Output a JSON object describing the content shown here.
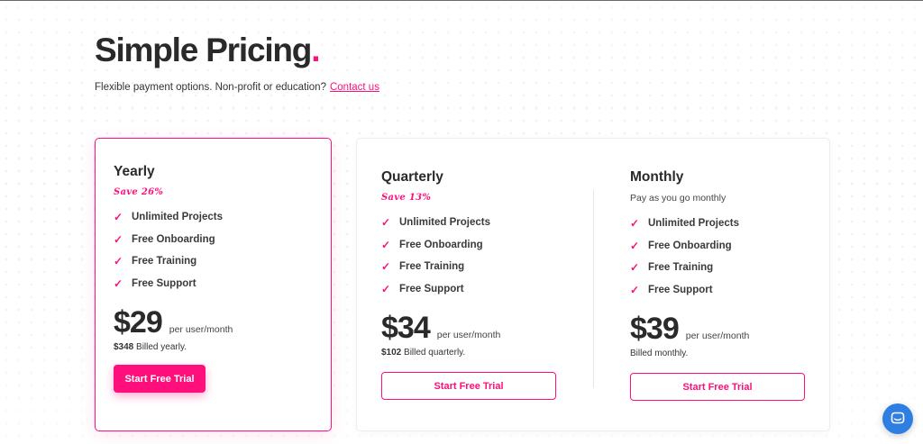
{
  "header": {
    "title": "Simple Pricing",
    "title_dot": ".",
    "subtitle": "Flexible payment options. Non-profit or education?",
    "contact_link": "Contact us"
  },
  "plans": [
    {
      "name": "Yearly",
      "save": "Save 26%",
      "note": "",
      "features": [
        "Unlimited Projects",
        "Free Onboarding",
        "Free Training",
        "Free Support"
      ],
      "price": "$29",
      "per": "per user/month",
      "billed_amount": "$348",
      "billed_text": "Billed yearly.",
      "cta": "Start Free Trial"
    },
    {
      "name": "Quarterly",
      "save": "Save 13%",
      "note": "",
      "features": [
        "Unlimited Projects",
        "Free Onboarding",
        "Free Training",
        "Free Support"
      ],
      "price": "$34",
      "per": "per user/month",
      "billed_amount": "$102",
      "billed_text": "Billed quarterly.",
      "cta": "Start Free Trial"
    },
    {
      "name": "Monthly",
      "save": "",
      "note": "Pay as you go monthly",
      "features": [
        "Unlimited Projects",
        "Free Onboarding",
        "Free Training",
        "Free Support"
      ],
      "price": "$39",
      "per": "per user/month",
      "billed_amount": "",
      "billed_text": "Billed monthly.",
      "cta": "Start Free Trial"
    }
  ],
  "icons": {
    "feature_check": "checkmark-icon",
    "chat": "chat-bubble-icon"
  },
  "colors": {
    "accent": "#ff0f7b",
    "text": "#2a2a2a",
    "chat_button": "#2f7fe3"
  }
}
